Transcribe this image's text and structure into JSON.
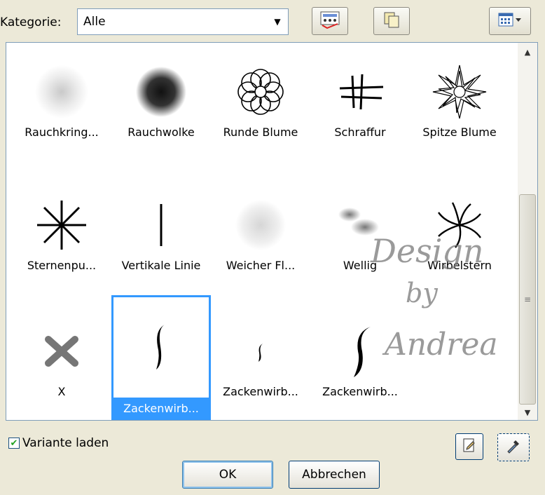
{
  "category": {
    "label": "Kategorie:",
    "selected": "Alle"
  },
  "toolbar": {
    "icons": [
      "preview-icon",
      "copy-icon",
      "view-mode-icon"
    ]
  },
  "items": [
    {
      "label": "Rauchkring...",
      "icon": "smoke-ring-brush-icon"
    },
    {
      "label": "Rauchwolke",
      "icon": "smoke-cloud-brush-icon"
    },
    {
      "label": "Runde Blume",
      "icon": "round-flower-brush-icon"
    },
    {
      "label": "Schraffur",
      "icon": "hatching-brush-icon"
    },
    {
      "label": "Spitze Blume",
      "icon": "pointed-flower-brush-icon"
    },
    {
      "label": "Sternenpu...",
      "icon": "star-burst-brush-icon"
    },
    {
      "label": "Vertikale Linie",
      "icon": "vertical-line-brush-icon"
    },
    {
      "label": "Weicher Fl...",
      "icon": "soft-spot-brush-icon"
    },
    {
      "label": "Wellig",
      "icon": "wavy-brush-icon"
    },
    {
      "label": "Wirbelstern",
      "icon": "swirl-star-brush-icon"
    },
    {
      "label": "X",
      "icon": "x-brush-icon"
    },
    {
      "label": "Zackenwirb...",
      "icon": "zigzag-swirl-brush-icon",
      "selected": true
    },
    {
      "label": "Zackenwirb...",
      "icon": "zigzag-swirl-small-brush-icon"
    },
    {
      "label": "Zackenwirb...",
      "icon": "zigzag-swirl-large-brush-icon"
    }
  ],
  "watermark": {
    "line1": "Design",
    "line2": "by",
    "line3": "Andrea"
  },
  "variant": {
    "label": "Variante laden",
    "checked": true
  },
  "buttons": {
    "ok": "OK",
    "cancel": "Abbrechen"
  },
  "colors": {
    "selection": "#3399ff",
    "dialog_bg": "#ece9d8"
  }
}
